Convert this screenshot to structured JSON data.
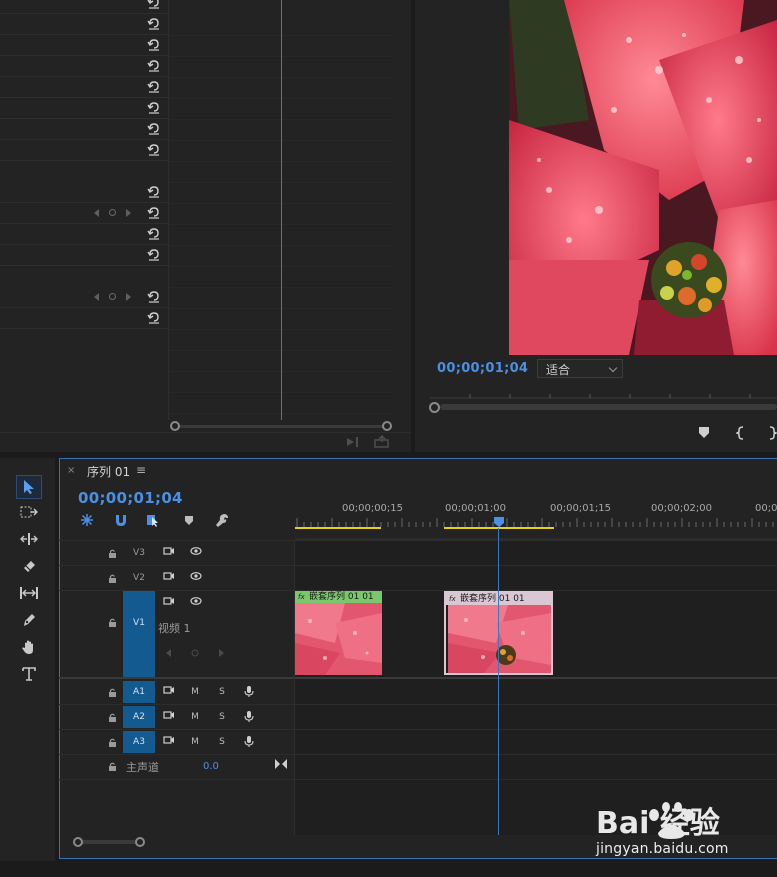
{
  "effect_controls": {
    "rows": [
      {
        "has_keyframes": false
      },
      {
        "has_keyframes": false
      },
      {
        "has_keyframes": false
      },
      {
        "has_keyframes": false
      },
      {
        "has_keyframes": false
      },
      {
        "has_keyframes": false
      },
      {
        "has_keyframes": false
      },
      {
        "has_keyframes": false
      },
      {
        "has_keyframes": false
      },
      {
        "has_keyframes": true
      },
      {
        "has_keyframes": false
      },
      {
        "has_keyframes": false
      },
      {
        "has_keyframes": true
      },
      {
        "has_keyframes": false
      }
    ]
  },
  "program_monitor": {
    "timecode": "00;00;01;04",
    "fit_select": "适合",
    "image": "poinsettia-red-flower"
  },
  "timeline": {
    "tab_title": "序列 01",
    "tab_close": "×",
    "tab_menu": "≡",
    "timecode": "00;00;01;04",
    "ruler_labels": [
      "00;00;00;15",
      "00;00;01;00",
      "00;00;01;15",
      "00;00;02;00",
      "00;0"
    ],
    "tracks": {
      "v3": "V3",
      "v2": "V2",
      "v1": "V1",
      "v1_label": "视频 1",
      "a1": "A1",
      "a2": "A2",
      "a3": "A3",
      "master": "主声道",
      "master_value": "0.0",
      "mute": "M",
      "solo": "S"
    },
    "clips": [
      {
        "name": "嵌套序列 01",
        "fx": "fx",
        "header_color": "#7bc86c"
      },
      {
        "name": "嵌套序列 01",
        "fx": "fx",
        "header_color": "#d9c8d4"
      }
    ]
  },
  "watermark": {
    "brand": "Bai 经验",
    "url": "jingyan.baidu.com"
  },
  "colors": {
    "accent_blue": "#4b90e2",
    "playhead": "#3b77c7",
    "track_blue": "#135a91",
    "work_area": "#e5d11a"
  }
}
